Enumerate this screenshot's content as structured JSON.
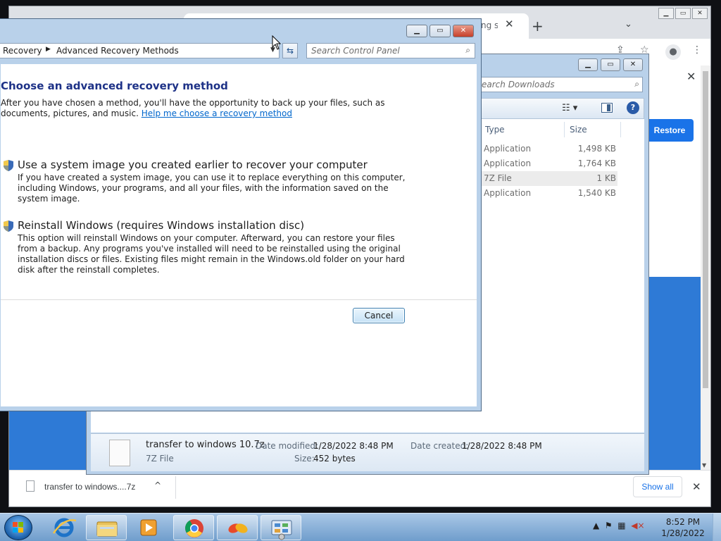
{
  "chrome": {
    "tab_title": "ng sı",
    "tab_close": "✕",
    "new_tab": "+",
    "tab_search": "⌄",
    "page_close": "✕",
    "restore_button": "Restore",
    "downloads_bar": {
      "file_name": "transfer to windows....7z",
      "chevron": "^",
      "show_all": "Show all",
      "close": "✕"
    }
  },
  "explorer": {
    "search_placeholder": "earch Downloads",
    "columns": {
      "type": "Type",
      "size": "Size"
    },
    "files": [
      {
        "type": "Application",
        "size": "1,498 KB"
      },
      {
        "type": "Application",
        "size": "1,764 KB"
      },
      {
        "type": "7Z File",
        "size": "1 KB"
      },
      {
        "type": "Application",
        "size": "1,540 KB"
      }
    ],
    "details": {
      "name": "transfer to windows 10.7z",
      "type": "7Z File",
      "modified_label": "Date modified:",
      "modified_value": "1/28/2022 8:48 PM",
      "created_label": "Date created:",
      "created_value": "1/28/2022 8:48 PM",
      "size_label": "Size:",
      "size_value": "452 bytes"
    }
  },
  "recovery": {
    "breadcrumb": [
      "Recovery",
      "Advanced Recovery Methods"
    ],
    "search_placeholder": "Search Control Panel",
    "heading": "Choose an advanced recovery method",
    "intro": "After you have chosen a method, you'll have the opportunity to back up your files, such as documents, pictures, and music.",
    "help_link": "Help me choose a recovery method",
    "options": [
      {
        "title": "Use a system image you created earlier to recover your computer",
        "description": "If you have created a system image, you can use it to replace everything on this computer, including Windows, your programs, and all your files, with the information saved on the system image."
      },
      {
        "title": "Reinstall Windows (requires Windows installation disc)",
        "description": "This option will reinstall Windows on your computer. Afterward, you can restore your files from a backup. Any programs you've installed will need to be reinstalled using the original installation discs or files. Existing files might remain in the Windows.old folder on your hard disk after the reinstall completes."
      }
    ],
    "cancel": "Cancel"
  },
  "taskbar": {
    "time": "8:52 PM",
    "date": "1/28/2022",
    "tray_chevron": "▲"
  }
}
